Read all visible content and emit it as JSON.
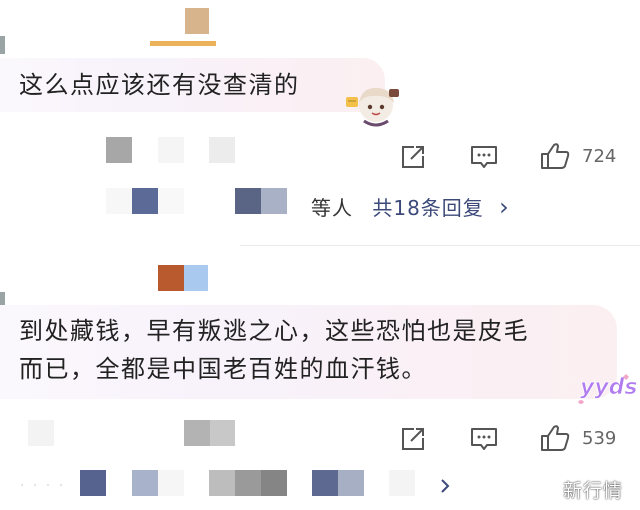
{
  "comments": [
    {
      "text_lines": [
        "这么点应该还有没查清的"
      ],
      "likes": "724"
    },
    {
      "text_lines": [
        "到处藏钱，早有叛逃之心，这些恐怕也是皮毛",
        "而已，全都是中国老百姓的血汗钱。"
      ],
      "likes": "539"
    }
  ],
  "reply_summary": {
    "prefix": "等人",
    "count_text": "共18条回复",
    "chevron": "›"
  },
  "icons": {
    "share": "share-icon",
    "comment": "comment-icon",
    "like": "thumbs-up-icon",
    "chevron": "chevron-right-icon",
    "sticker": "chibi-sticker-icon"
  },
  "sticker_text": "yyds",
  "watermark": "新行情",
  "colors": {
    "bubble_start": "#fbf8fd",
    "bubble_end": "#fbeff1",
    "reply_link": "#3c4a7a",
    "count_gray": "#666666",
    "sticker_purple": "#b07cf0"
  }
}
